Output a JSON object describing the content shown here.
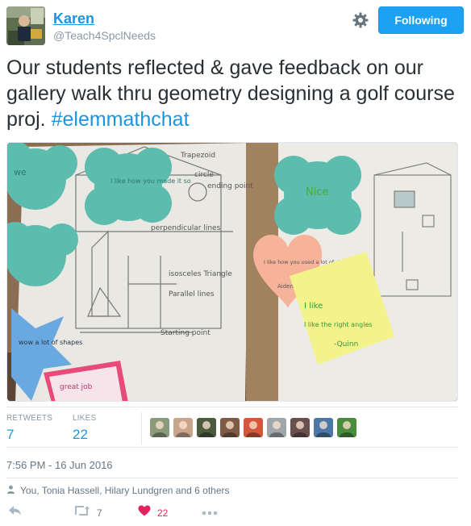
{
  "user": {
    "name": "Karen",
    "handle": "@Teach4SpclNeeds"
  },
  "follow_button": {
    "label": "Following"
  },
  "tweet": {
    "text": "Our students reflected & gave feedback on our gallery walk thru geometry designing a golf course proj. ",
    "hashtag": "#elemmathchat"
  },
  "photo": {
    "notes": {
      "note_1": "I like how you made it so",
      "note_2": "I like how you used a lot of shapes",
      "note_3": "I like the right angles",
      "note_4": "wow a lot of shapes",
      "note_5": "great job",
      "note_6": "Nice",
      "note_7": "we",
      "note_8": "I like",
      "author_1": "-Quinn",
      "author_2": "Aiden"
    },
    "drawing": {
      "label_1": "Trapezoid",
      "label_2": "circle",
      "label_3": "ending point",
      "label_4": "perpendicular lines",
      "label_5": "isosceles Triangle",
      "label_6": "Parallel lines",
      "label_7": "Starting point"
    }
  },
  "stats": {
    "retweets_label": "RETWEETS",
    "retweets_value": "7",
    "likes_label": "LIKES",
    "likes_value": "22"
  },
  "likers": {
    "count": 9,
    "colors": [
      "#8a9a7a",
      "#c9a58c",
      "#4c5b3e",
      "#7e5a44",
      "#d3573b",
      "#a0a7ab",
      "#6a4f4f",
      "#4c77a7",
      "#4a8c3e"
    ]
  },
  "timestamp": "7:56 PM - 16 Jun 2016",
  "liked_by": "You, Tonia Hassell, Hilary Lundgren and 6 others",
  "actions": {
    "retweet_count": "7",
    "like_count": "22"
  },
  "colors": {
    "accent": "#1b95e0",
    "like": "#e0245e",
    "muted": "#657786"
  },
  "icons": [
    "gear-icon",
    "reply-icon",
    "retweet-icon",
    "heart-icon",
    "more-icon",
    "person-icon"
  ]
}
